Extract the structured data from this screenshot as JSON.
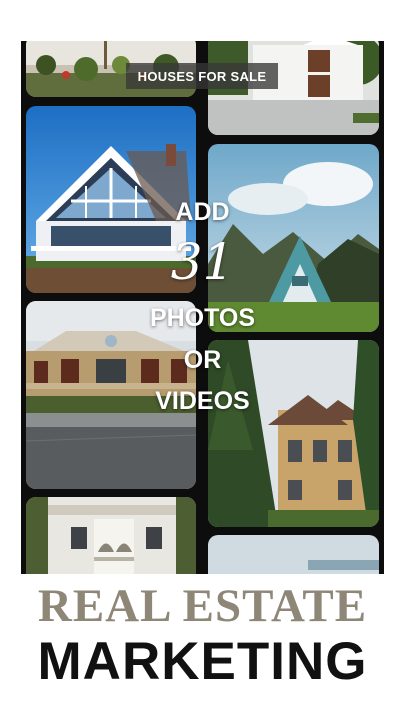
{
  "badge": {
    "text": "HOUSES FOR SALE"
  },
  "overlay": {
    "line1": "ADD",
    "number": "31",
    "line3": "PHOTOS",
    "line4": "OR",
    "line5": "VIDEOS"
  },
  "title": {
    "line1": "REAL ESTATE",
    "line2": "MARKETING"
  }
}
